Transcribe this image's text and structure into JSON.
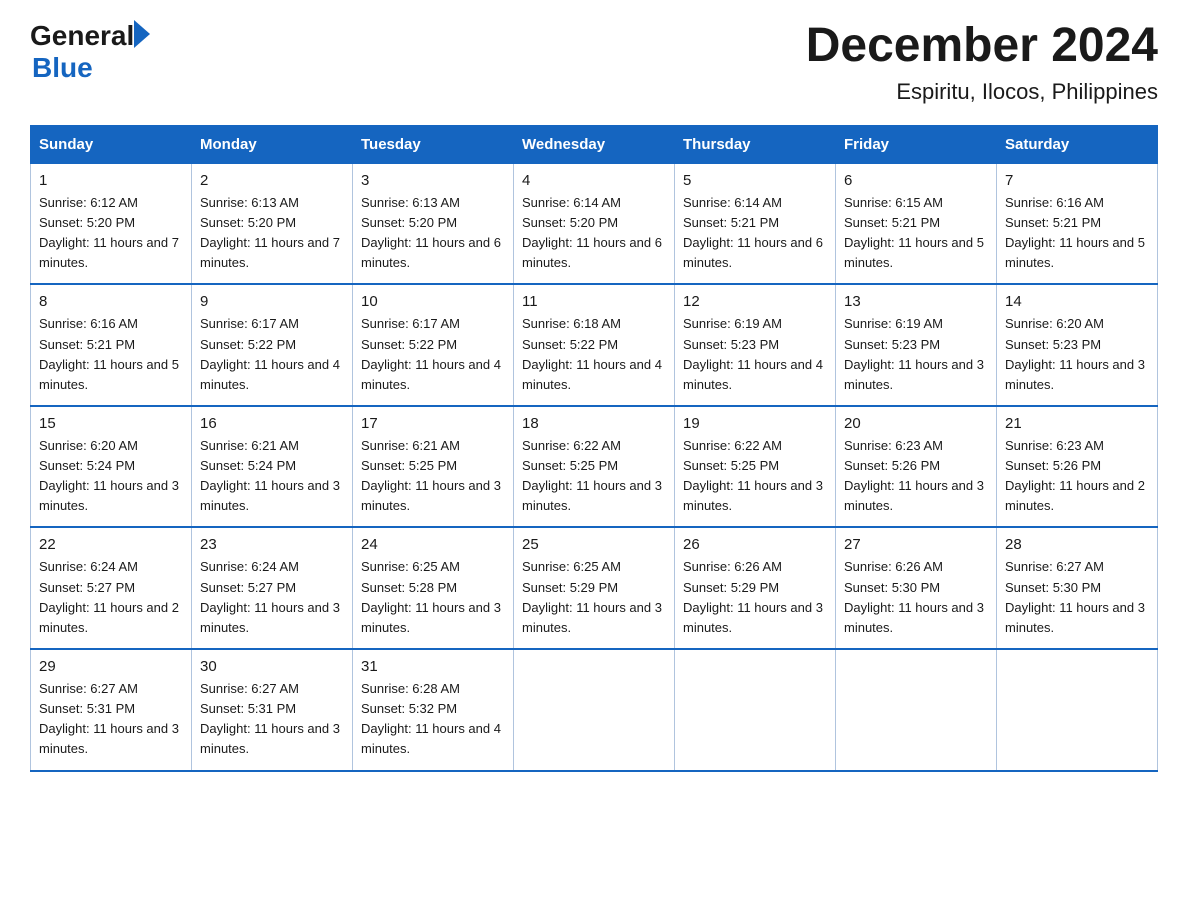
{
  "logo": {
    "general": "General",
    "blue": "Blue"
  },
  "title": {
    "month_year": "December 2024",
    "location": "Espiritu, Ilocos, Philippines"
  },
  "weekdays": [
    "Sunday",
    "Monday",
    "Tuesday",
    "Wednesday",
    "Thursday",
    "Friday",
    "Saturday"
  ],
  "weeks": [
    [
      {
        "day": "1",
        "sunrise": "6:12 AM",
        "sunset": "5:20 PM",
        "daylight": "11 hours and 7 minutes."
      },
      {
        "day": "2",
        "sunrise": "6:13 AM",
        "sunset": "5:20 PM",
        "daylight": "11 hours and 7 minutes."
      },
      {
        "day": "3",
        "sunrise": "6:13 AM",
        "sunset": "5:20 PM",
        "daylight": "11 hours and 6 minutes."
      },
      {
        "day": "4",
        "sunrise": "6:14 AM",
        "sunset": "5:20 PM",
        "daylight": "11 hours and 6 minutes."
      },
      {
        "day": "5",
        "sunrise": "6:14 AM",
        "sunset": "5:21 PM",
        "daylight": "11 hours and 6 minutes."
      },
      {
        "day": "6",
        "sunrise": "6:15 AM",
        "sunset": "5:21 PM",
        "daylight": "11 hours and 5 minutes."
      },
      {
        "day": "7",
        "sunrise": "6:16 AM",
        "sunset": "5:21 PM",
        "daylight": "11 hours and 5 minutes."
      }
    ],
    [
      {
        "day": "8",
        "sunrise": "6:16 AM",
        "sunset": "5:21 PM",
        "daylight": "11 hours and 5 minutes."
      },
      {
        "day": "9",
        "sunrise": "6:17 AM",
        "sunset": "5:22 PM",
        "daylight": "11 hours and 4 minutes."
      },
      {
        "day": "10",
        "sunrise": "6:17 AM",
        "sunset": "5:22 PM",
        "daylight": "11 hours and 4 minutes."
      },
      {
        "day": "11",
        "sunrise": "6:18 AM",
        "sunset": "5:22 PM",
        "daylight": "11 hours and 4 minutes."
      },
      {
        "day": "12",
        "sunrise": "6:19 AM",
        "sunset": "5:23 PM",
        "daylight": "11 hours and 4 minutes."
      },
      {
        "day": "13",
        "sunrise": "6:19 AM",
        "sunset": "5:23 PM",
        "daylight": "11 hours and 3 minutes."
      },
      {
        "day": "14",
        "sunrise": "6:20 AM",
        "sunset": "5:23 PM",
        "daylight": "11 hours and 3 minutes."
      }
    ],
    [
      {
        "day": "15",
        "sunrise": "6:20 AM",
        "sunset": "5:24 PM",
        "daylight": "11 hours and 3 minutes."
      },
      {
        "day": "16",
        "sunrise": "6:21 AM",
        "sunset": "5:24 PM",
        "daylight": "11 hours and 3 minutes."
      },
      {
        "day": "17",
        "sunrise": "6:21 AM",
        "sunset": "5:25 PM",
        "daylight": "11 hours and 3 minutes."
      },
      {
        "day": "18",
        "sunrise": "6:22 AM",
        "sunset": "5:25 PM",
        "daylight": "11 hours and 3 minutes."
      },
      {
        "day": "19",
        "sunrise": "6:22 AM",
        "sunset": "5:25 PM",
        "daylight": "11 hours and 3 minutes."
      },
      {
        "day": "20",
        "sunrise": "6:23 AM",
        "sunset": "5:26 PM",
        "daylight": "11 hours and 3 minutes."
      },
      {
        "day": "21",
        "sunrise": "6:23 AM",
        "sunset": "5:26 PM",
        "daylight": "11 hours and 2 minutes."
      }
    ],
    [
      {
        "day": "22",
        "sunrise": "6:24 AM",
        "sunset": "5:27 PM",
        "daylight": "11 hours and 2 minutes."
      },
      {
        "day": "23",
        "sunrise": "6:24 AM",
        "sunset": "5:27 PM",
        "daylight": "11 hours and 3 minutes."
      },
      {
        "day": "24",
        "sunrise": "6:25 AM",
        "sunset": "5:28 PM",
        "daylight": "11 hours and 3 minutes."
      },
      {
        "day": "25",
        "sunrise": "6:25 AM",
        "sunset": "5:29 PM",
        "daylight": "11 hours and 3 minutes."
      },
      {
        "day": "26",
        "sunrise": "6:26 AM",
        "sunset": "5:29 PM",
        "daylight": "11 hours and 3 minutes."
      },
      {
        "day": "27",
        "sunrise": "6:26 AM",
        "sunset": "5:30 PM",
        "daylight": "11 hours and 3 minutes."
      },
      {
        "day": "28",
        "sunrise": "6:27 AM",
        "sunset": "5:30 PM",
        "daylight": "11 hours and 3 minutes."
      }
    ],
    [
      {
        "day": "29",
        "sunrise": "6:27 AM",
        "sunset": "5:31 PM",
        "daylight": "11 hours and 3 minutes."
      },
      {
        "day": "30",
        "sunrise": "6:27 AM",
        "sunset": "5:31 PM",
        "daylight": "11 hours and 3 minutes."
      },
      {
        "day": "31",
        "sunrise": "6:28 AM",
        "sunset": "5:32 PM",
        "daylight": "11 hours and 4 minutes."
      },
      null,
      null,
      null,
      null
    ]
  ]
}
